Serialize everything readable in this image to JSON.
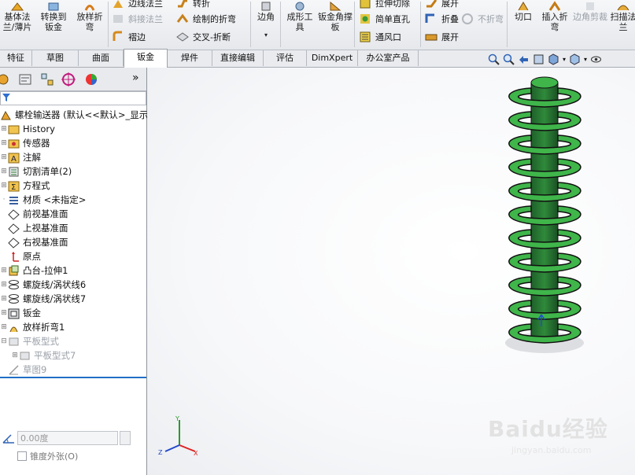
{
  "toolbar": {
    "base_flange": "基体法兰/薄片",
    "convert_sheet": "转换到钣金",
    "lofted_bend": "放样折弯",
    "edge_flange": "边线法兰",
    "miter_flange": "斜接法兰",
    "hem": "褶边",
    "jog": "转折",
    "sketched_bend": "绘制的折弯",
    "cross_break": "交叉-折断",
    "corner": "边角",
    "forming_tool": "成形工具",
    "gusset": "钣金角撑板",
    "extruded_cut": "拉伸切除",
    "simple_hole": "简单直孔",
    "vent": "通风口",
    "unfold": "展开",
    "fold": "折叠",
    "flatten": "展开",
    "no_bends": "不折弯",
    "rip": "切口",
    "insert_bends": "插入折弯",
    "corner_trim": "边角剪裁",
    "scan": "扫描法兰"
  },
  "tabs": [
    {
      "label": "特征"
    },
    {
      "label": "草图"
    },
    {
      "label": "曲面"
    },
    {
      "label": "钣金"
    },
    {
      "label": "焊件"
    },
    {
      "label": "直接编辑"
    },
    {
      "label": "评估"
    },
    {
      "label": "DimXpert"
    },
    {
      "label": "办公室产品"
    }
  ],
  "tree": {
    "root": "螺栓输送器 (默认<<默认>_显示",
    "items": [
      {
        "label": "History"
      },
      {
        "label": "传感器"
      },
      {
        "label": "注解"
      },
      {
        "label": "切割清单(2)"
      },
      {
        "label": "方程式"
      },
      {
        "label": "材质 <未指定>"
      },
      {
        "label": "前视基准面"
      },
      {
        "label": "上视基准面"
      },
      {
        "label": "右视基准面"
      },
      {
        "label": "原点"
      },
      {
        "label": "凸台-拉伸1"
      },
      {
        "label": "螺旋线/涡状线6"
      },
      {
        "label": "螺旋线/涡状线7"
      },
      {
        "label": "钣金"
      },
      {
        "label": "放样折弯1"
      },
      {
        "label": "平板型式"
      },
      {
        "label": "平板型式7"
      },
      {
        "label": "草图9"
      }
    ]
  },
  "props": {
    "angle_value": "0.00度",
    "taper_label": "锥度外张(O)"
  },
  "triad": {
    "y": "Y",
    "z": "Z",
    "x": "X"
  },
  "watermark": {
    "brand": "Baidu经验",
    "url": "jingyan.baidu.com"
  },
  "colors": {
    "accent": "#1f6fc5",
    "part_green": "#3fb54a",
    "shaft_green": "#2f7d3a"
  }
}
